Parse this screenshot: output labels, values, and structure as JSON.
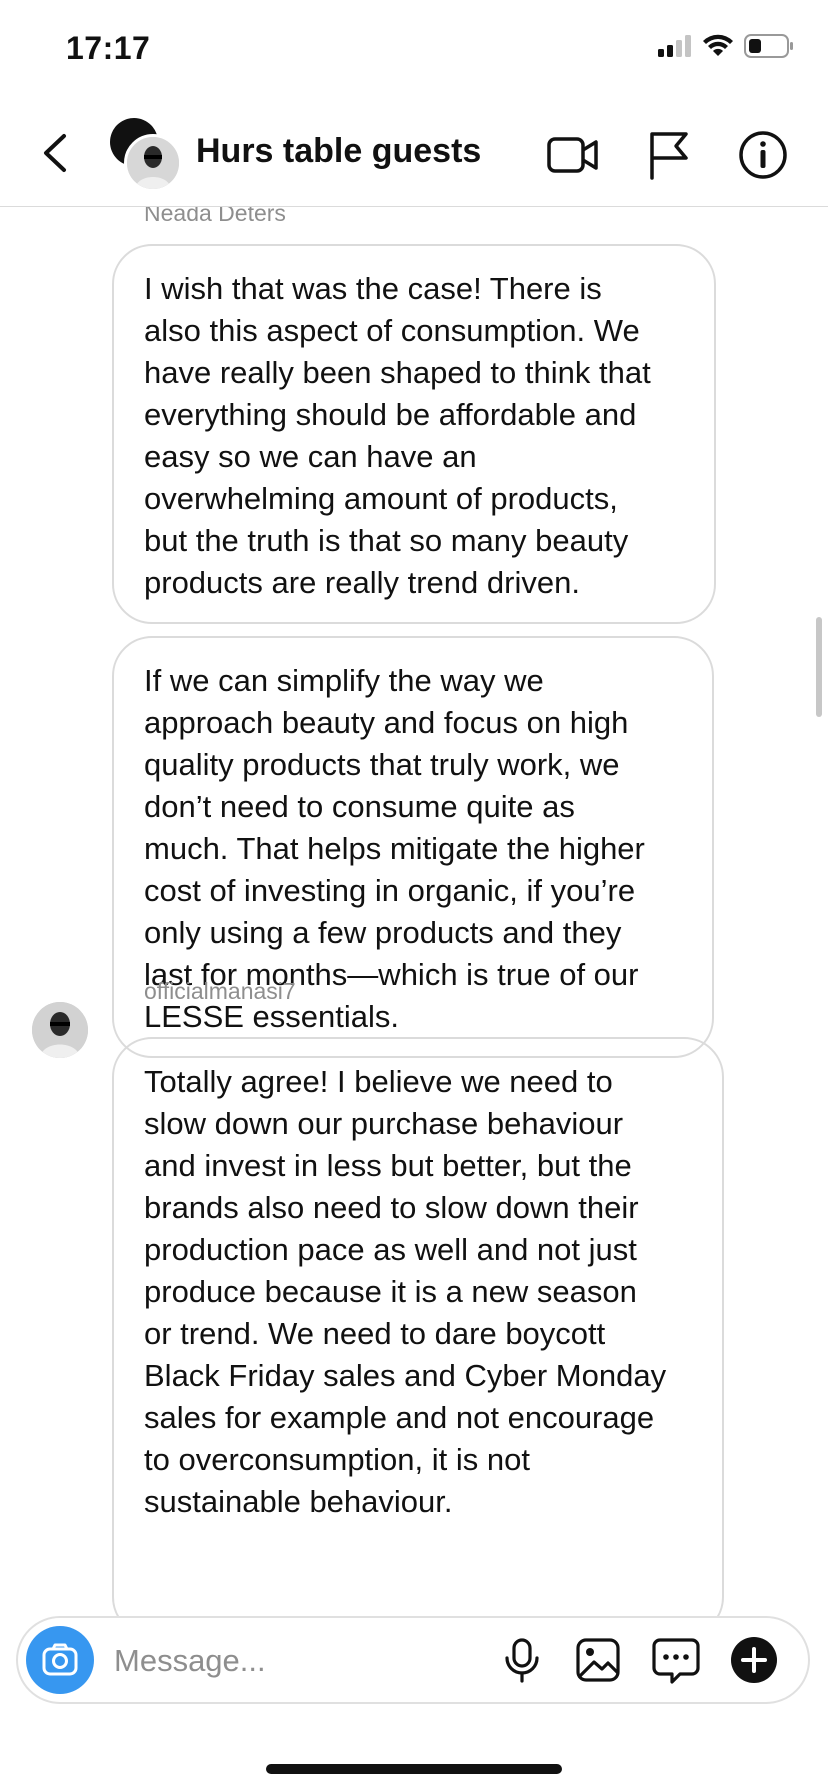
{
  "status": {
    "time": "17:17"
  },
  "header": {
    "title": "Hurs table guests"
  },
  "messages": [
    {
      "sender": "Neada Deters",
      "text": "I wish that was the case! There is\nalso this aspect of consumption. We\nhave really been shaped to think that\neverything should be affordable and\neasy so we can have an\noverwhelming amount of products,\nbut the truth is that so many beauty\nproducts are really trend driven."
    },
    {
      "sender": "",
      "text": "If we can simplify the way we\napproach beauty and focus on high\nquality products that truly work, we\ndon’t need to consume quite as\nmuch. That helps mitigate the higher\ncost of investing in organic, if you’re\nonly using a few products and they\nlast for months—which is true of our\nLESSE essentials."
    },
    {
      "sender": "officialmanasi7",
      "text": "Totally agree! I believe we  need to\nslow down our purchase behaviour\nand invest in less but better, but the\nbrands also need to slow down their\nproduction pace as well and not just\nproduce because it is a new season\nor trend. We need to dare boycott\nBlack Friday sales and Cyber Monday\nsales for example and not encourage\nto overconsumption, it is not\nsustainable behaviour."
    }
  ],
  "composer": {
    "placeholder": "Message..."
  },
  "colors": {
    "accent": "#3797f0",
    "border": "#dbdbdb",
    "muted": "#8e8e8e"
  }
}
